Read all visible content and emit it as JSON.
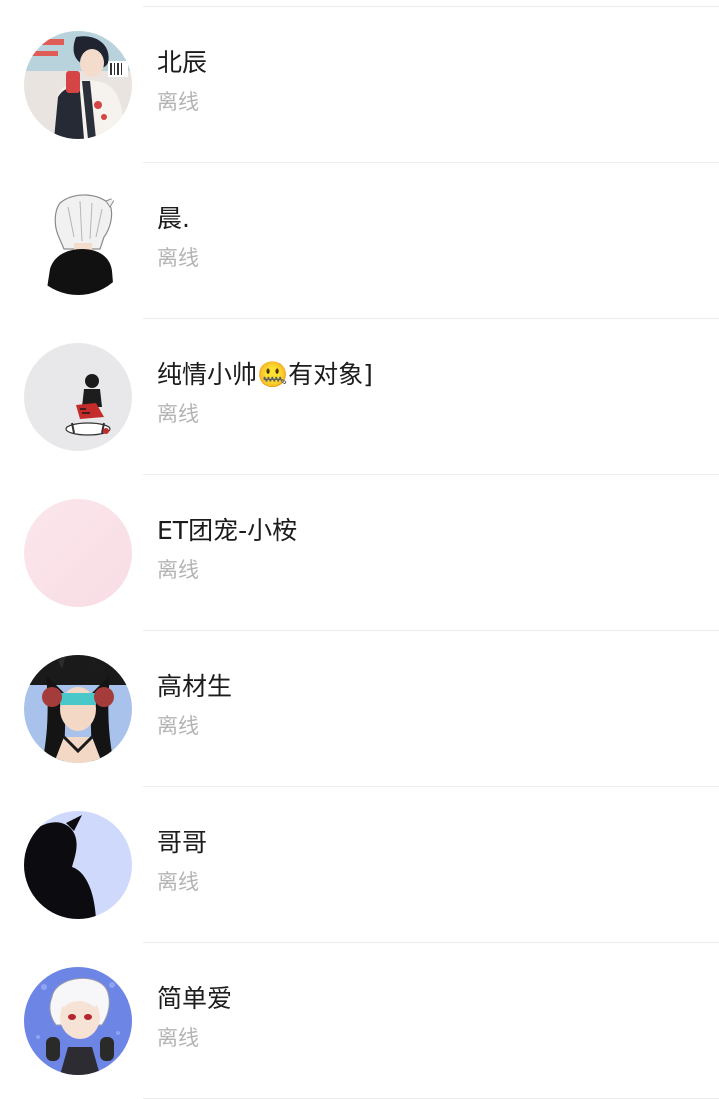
{
  "contacts": [
    {
      "name": "北辰",
      "status": "离线",
      "avatar": "avatar-dark-hair-boy"
    },
    {
      "name": "晨.",
      "status": "离线",
      "avatar": "avatar-white-hair-back"
    },
    {
      "name": "纯情小帅🤐有对象]",
      "status": "离线",
      "avatar": "avatar-sitting-figure"
    },
    {
      "name": "ET团宠-小桉",
      "status": "离线",
      "avatar": "avatar-pink-blank"
    },
    {
      "name": "高材生",
      "status": "离线",
      "avatar": "avatar-headphones-girl"
    },
    {
      "name": "哥哥",
      "status": "离线",
      "avatar": "avatar-silhouette"
    },
    {
      "name": "简单爱",
      "status": "离线",
      "avatar": "avatar-white-hair-boy"
    }
  ]
}
